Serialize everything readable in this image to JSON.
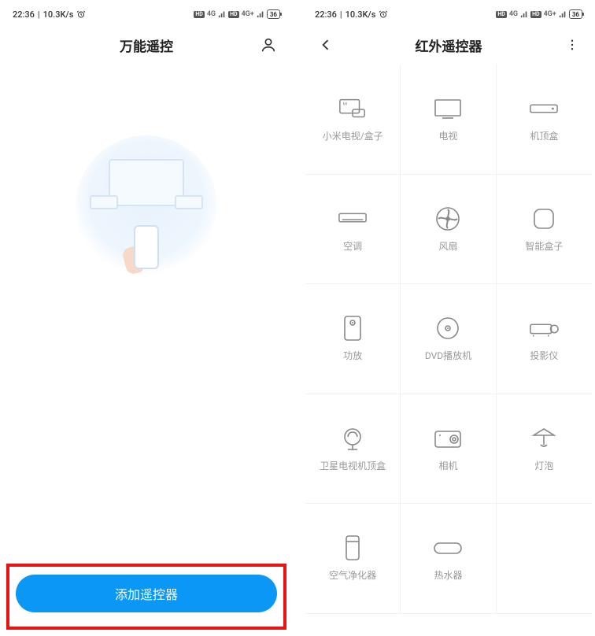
{
  "status": {
    "time": "22:36",
    "speed": "10.3K/s",
    "hd1": "HD",
    "net1": "4G",
    "hd2": "HD",
    "net2": "4G+",
    "battery": "36"
  },
  "left_screen": {
    "title": "万能遥控",
    "add_button": "添加遥控器"
  },
  "right_screen": {
    "title": "红外遥控器",
    "devices": [
      {
        "label": "小米电视/盒子"
      },
      {
        "label": "电视"
      },
      {
        "label": "机顶盒"
      },
      {
        "label": "空调"
      },
      {
        "label": "风扇"
      },
      {
        "label": "智能盒子"
      },
      {
        "label": "功放"
      },
      {
        "label": "DVD播放机"
      },
      {
        "label": "投影仪"
      },
      {
        "label": "卫星电视机顶盒"
      },
      {
        "label": "相机"
      },
      {
        "label": "灯泡"
      },
      {
        "label": "空气净化器"
      },
      {
        "label": "热水器"
      },
      {
        "label": ""
      }
    ]
  }
}
